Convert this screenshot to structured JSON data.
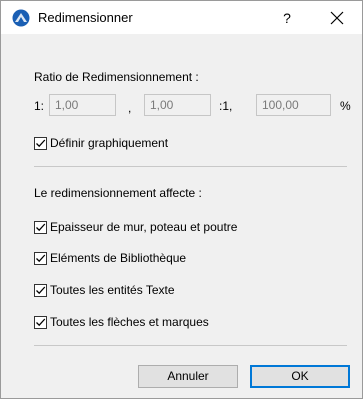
{
  "window": {
    "title": "Redimensionner",
    "help": "?",
    "close": "✕"
  },
  "ratio": {
    "heading": "Ratio de Redimensionnement :",
    "prefix": "1:",
    "value1": "1,00",
    "sep1": ",",
    "value2": "1,00",
    "sep2": ":1,",
    "percent_value": "100,00",
    "percent_sign": "%"
  },
  "define_graphically": {
    "label": "Définir graphiquement",
    "checked": true
  },
  "affects": {
    "heading": "Le redimensionnement affecte :",
    "items": [
      {
        "label": "Epaisseur de mur, poteau et poutre",
        "checked": true
      },
      {
        "label": "Eléments de Bibliothèque",
        "checked": true
      },
      {
        "label": "Toutes les entités Texte",
        "checked": true
      },
      {
        "label": "Toutes les flèches et marques",
        "checked": true
      }
    ]
  },
  "buttons": {
    "cancel": "Annuler",
    "ok": "OK"
  },
  "colors": {
    "accent": "#0078d7",
    "window_bg": "#f0f0f0",
    "icon_blue": "#1a5fb4"
  }
}
